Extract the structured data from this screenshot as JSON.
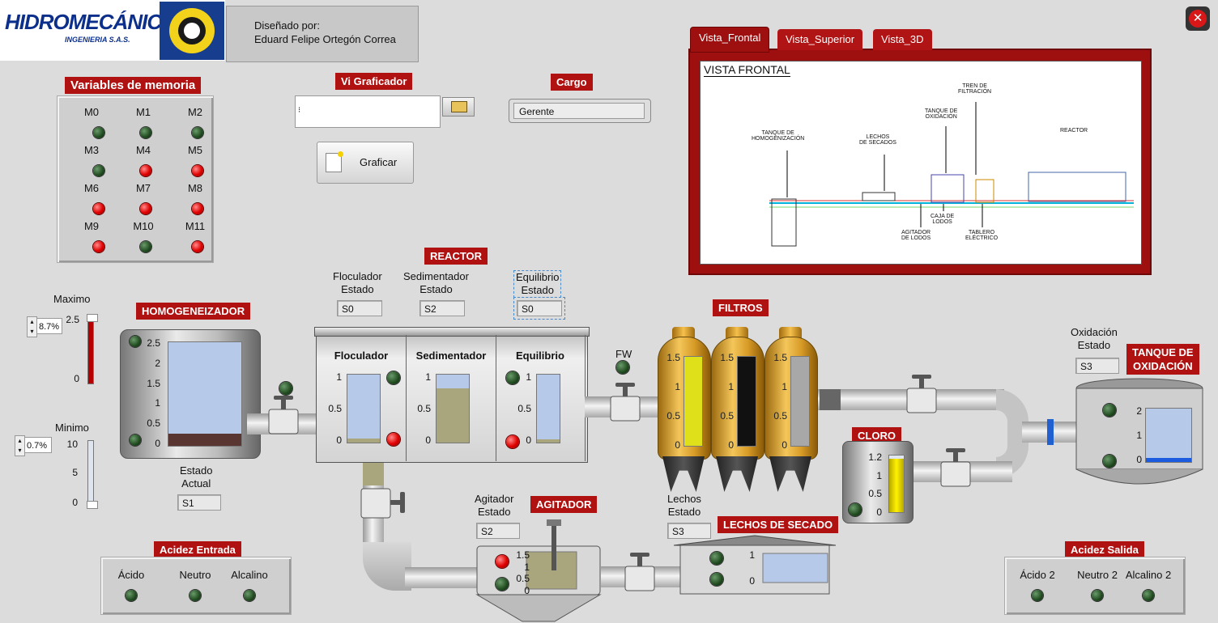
{
  "header": {
    "logo_text": "HIDROMECÁNICA",
    "logo_sub": "INGENIERIA S.A.S.",
    "designed_by_label": "Diseñado por:",
    "designer_name": "Eduard Felipe Ortegón Correa",
    "close_icon": "close-icon"
  },
  "memory": {
    "title": "Variables de memoria",
    "items": [
      {
        "label": "M0",
        "state": "off"
      },
      {
        "label": "M1",
        "state": "off"
      },
      {
        "label": "M2",
        "state": "off"
      },
      {
        "label": "M3",
        "state": "off"
      },
      {
        "label": "M4",
        "state": "on"
      },
      {
        "label": "M5",
        "state": "on"
      },
      {
        "label": "M6",
        "state": "on"
      },
      {
        "label": "M7",
        "state": "on"
      },
      {
        "label": "M8",
        "state": "on"
      },
      {
        "label": "M9",
        "state": "on"
      },
      {
        "label": "M10",
        "state": "off"
      },
      {
        "label": "M11",
        "state": "on"
      }
    ]
  },
  "graficador": {
    "title": "Vi Graficador",
    "path_value": "",
    "button_label": "Graficar",
    "folder_icon": "folder-open-icon"
  },
  "cargo": {
    "title": "Cargo",
    "value": "Gerente"
  },
  "views": {
    "tabs": [
      "Vista_Frontal",
      "Vista_Superior",
      "Vista_3D"
    ],
    "active": 0,
    "frontal": {
      "title": "VISTA FRONTAL",
      "labels": {
        "homog": "TANQUE DE\nHOMOGENIZACIÓN",
        "lechos": "LECHOS\nDE SECADOS",
        "oxid": "TANQUE DE\nOXIDACIÓN",
        "tren": "TREN DE\nFILTRACIÓN",
        "reactor": "REACTOR",
        "caja": "CAJA DE\nLODOS",
        "agit": "AGITADOR\nDE LODOS",
        "tablero": "TABLERO\nELÉCTRICO"
      }
    }
  },
  "levels": {
    "max_label": "Maximo",
    "max_value": "8.7%",
    "max_scale": [
      "2.5",
      "0"
    ],
    "min_label": "Minimo",
    "min_value": "0.7%",
    "min_scale": [
      "10",
      "5",
      "0"
    ]
  },
  "homogeneizador": {
    "title": "HOMOGENEIZADOR",
    "scale": [
      "2.5",
      "2",
      "1.5",
      "1",
      "0.5",
      "0"
    ],
    "fill": 0.08,
    "estado_label": "Estado\nActual",
    "estado_value": "S1"
  },
  "reactor": {
    "title": "REACTOR",
    "states": [
      {
        "label": "Floculador\nEstado",
        "value": "S0"
      },
      {
        "label": "Sedimentador\nEstado",
        "value": "S2"
      },
      {
        "label": "Equilibrio\nEstado",
        "value": "S0"
      }
    ],
    "chambers": [
      {
        "name": "Floculador",
        "scale": [
          "1",
          "0.5",
          "0"
        ],
        "fill": 0.06
      },
      {
        "name": "Sedimentador",
        "scale": [
          "1",
          "0.5",
          "0"
        ],
        "fill": 0.8
      },
      {
        "name": "Equilibrio",
        "scale": [
          "1",
          "0.5",
          "0"
        ],
        "fill": 0.05
      }
    ]
  },
  "fw_label": "FW",
  "filtros": {
    "title": "FILTROS",
    "scale": [
      "1.5",
      "1",
      "0.5",
      "0"
    ],
    "fills": [
      1.0,
      1.0,
      1.0
    ]
  },
  "oxidacion": {
    "title": "TANQUE DE\nOXIDACIÓN",
    "estado_label": "Oxidación\nEstado",
    "estado_value": "S3",
    "scale": [
      "2",
      "1",
      "0"
    ],
    "fill": 0.08
  },
  "cloro": {
    "title": "CLORO",
    "scale": [
      "1.2",
      "1",
      "0.5",
      "0"
    ],
    "fill": 0.95
  },
  "agitador": {
    "title": "AGITADOR",
    "estado_label": "Agitador\nEstado",
    "estado_value": "S2",
    "scale": [
      "1.5",
      "1",
      "0.5",
      "0"
    ],
    "fill": 0.9
  },
  "lechos": {
    "title": "LECHOS DE SECADO",
    "estado_label": "Lechos\nEstado",
    "estado_value": "S3",
    "scale": [
      "1",
      "0"
    ],
    "fill": 0.3
  },
  "acidez_entrada": {
    "title": "Acidez Entrada",
    "labels": [
      "Ácido",
      "Neutro",
      "Alcalino"
    ]
  },
  "acidez_salida": {
    "title": "Acidez Salida",
    "labels": [
      "Ácido 2",
      "Neutro 2",
      "Alcalino 2"
    ]
  },
  "colors": {
    "accent_red": "#b01212",
    "led_green": "#1f4a1f",
    "led_red": "#e00000",
    "water": "#b7c9e8",
    "sludge": "#a9a67e"
  }
}
